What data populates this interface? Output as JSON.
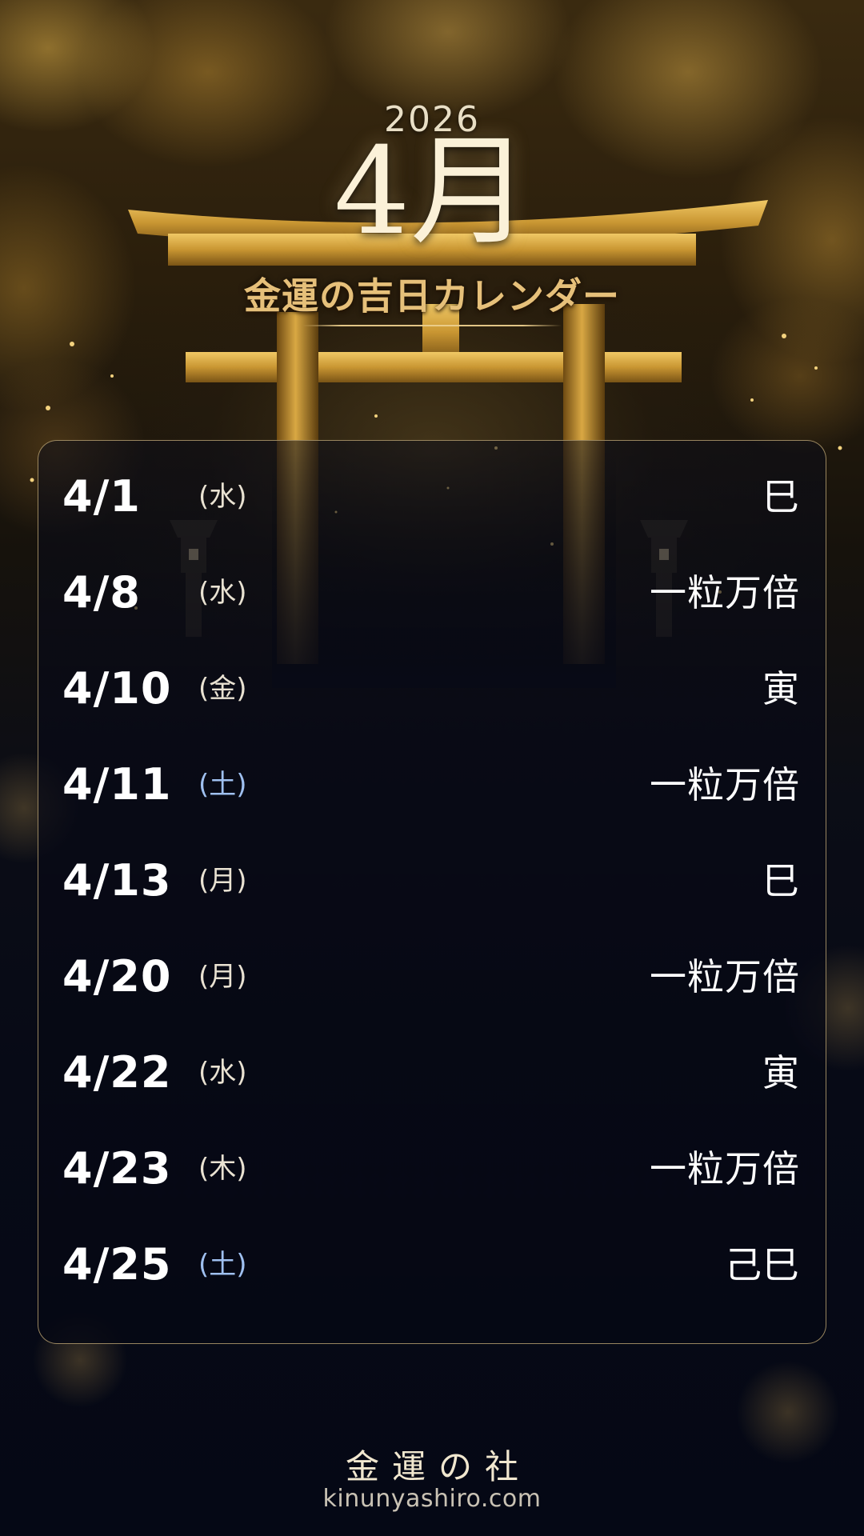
{
  "header": {
    "year": "2026",
    "month": "4月",
    "subtitle": "金運の吉日カレンダー"
  },
  "calendar": {
    "entries": [
      {
        "date": "4/1",
        "weekday": "(水)",
        "saturday": false,
        "label": "巳"
      },
      {
        "date": "4/8",
        "weekday": "(水)",
        "saturday": false,
        "label": "一粒万倍"
      },
      {
        "date": "4/10",
        "weekday": "(金)",
        "saturday": false,
        "label": "寅"
      },
      {
        "date": "4/11",
        "weekday": "(土)",
        "saturday": true,
        "label": "一粒万倍"
      },
      {
        "date": "4/13",
        "weekday": "(月)",
        "saturday": false,
        "label": "巳"
      },
      {
        "date": "4/20",
        "weekday": "(月)",
        "saturday": false,
        "label": "一粒万倍"
      },
      {
        "date": "4/22",
        "weekday": "(水)",
        "saturday": false,
        "label": "寅"
      },
      {
        "date": "4/23",
        "weekday": "(木)",
        "saturday": false,
        "label": "一粒万倍"
      },
      {
        "date": "4/25",
        "weekday": "(土)",
        "saturday": true,
        "label": "己巳"
      }
    ]
  },
  "footer": {
    "brand": "金運の社",
    "url": "kinunyashiro.com"
  },
  "colors": {
    "accent_gold": "#e6c07a",
    "saturday_blue": "#9fc0f0",
    "panel_border": "#c8af78",
    "background_navy": "#060a16"
  },
  "icons": {
    "background_art": "golden-torii-gate-icon"
  }
}
